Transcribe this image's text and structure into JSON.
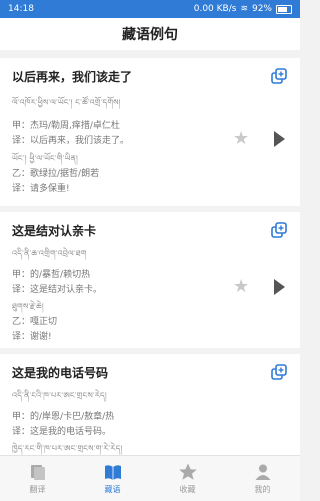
{
  "status": {
    "time": "14:18",
    "net": "0.00 KB/s",
    "battery": "92%"
  },
  "header": {
    "title": "藏语例句"
  },
  "colors": {
    "accent": "#2f7bd6",
    "text": "#333333",
    "muted": "#888888"
  },
  "cards": [
    {
      "title": "以后再来，我们该走了",
      "tib1": "ལོ་འཁོར་ཕྱིས་ལ་ཡོང་། ང་ཚོ་འགྲོ་དགོས།",
      "l1": "甲：杰玛/勒周,痒措/卓仁杜",
      "l2": "译：以后再来，我们该走了。",
      "tib2": "ཡོང་། ཕྱི་ལ་ཡོང་གི་ཡིན།",
      "l3": "乙：歌绿拉/据哲/朗若",
      "l4": "译：请多保重!"
    },
    {
      "title": "这是结对认亲卡",
      "tib1": "འདི་ནི་ཆ་འགྲིག་འབྲེལ་ཐག",
      "l1": "甲：的/暴哲/赖切热",
      "l2": "译：这是结对认亲卡。",
      "tib2": "ཐུགས་རྗེ་ཆེ།",
      "l3": "乙：嘎正切",
      "l4": "译：谢谢!"
    },
    {
      "title": "这是我的电话号码",
      "tib1": "འདི་ནི་ངའི་ཁ་པར་ཨང་གྲངས་རེད།",
      "l1": "甲：的/岸恩/卡巴/敖章/热",
      "l2": "译：这是我的电话号码。",
      "tib2": "ཁྱེད་རང་གི་ཁ་པར་ཨང་གྲངས་ག་རེ་རེད།"
    }
  ],
  "tabs": [
    {
      "label": "翻译",
      "icon": "translate-icon"
    },
    {
      "label": "藏语",
      "icon": "book-icon"
    },
    {
      "label": "收藏",
      "icon": "star-icon"
    },
    {
      "label": "我的",
      "icon": "user-icon"
    }
  ]
}
